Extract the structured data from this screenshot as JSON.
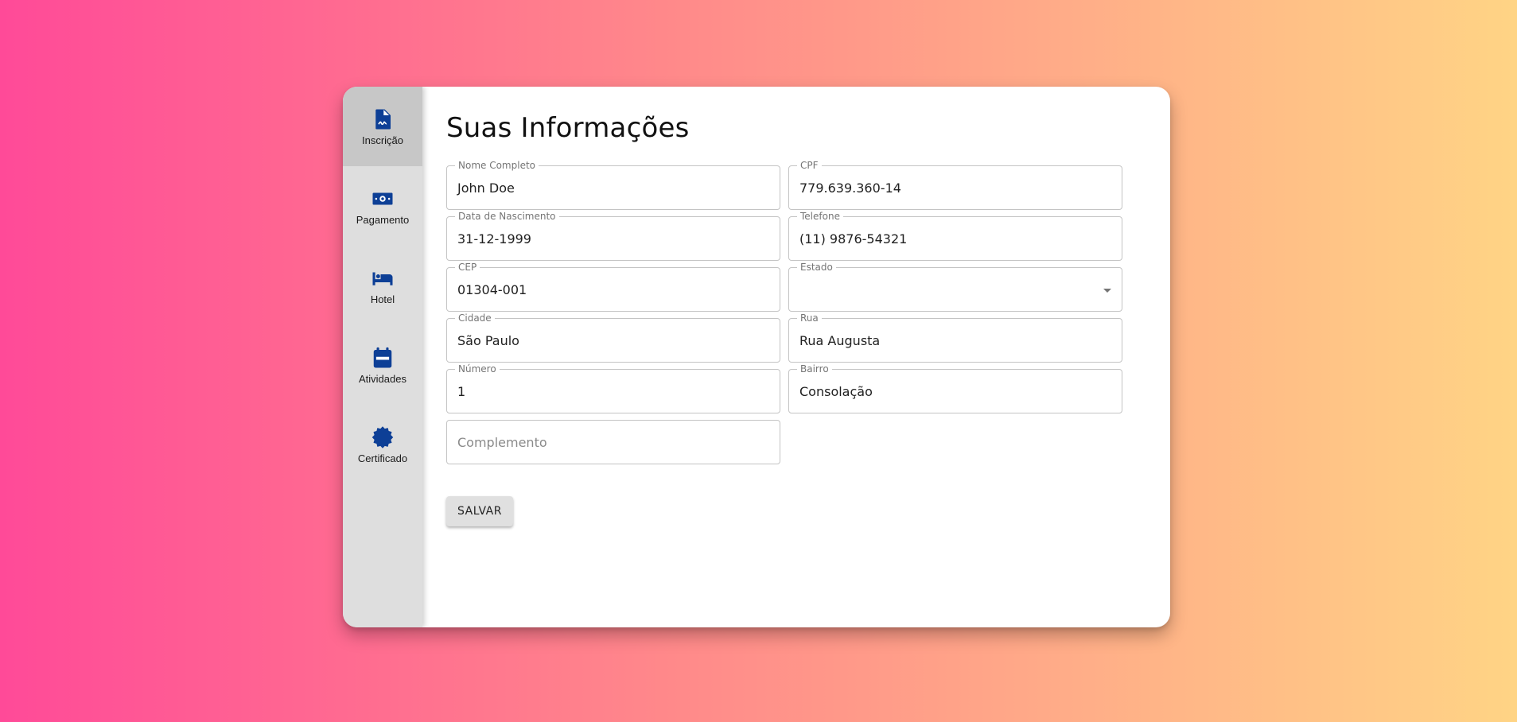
{
  "theme": {
    "accent": "#0d3f96",
    "sidebar_bg": "#dedede",
    "active_bg": "#c7c7c7"
  },
  "sidebar": {
    "items": [
      {
        "label": "Inscrição",
        "icon": "document-signature-icon",
        "active": true
      },
      {
        "label": "Pagamento",
        "icon": "banknote-icon",
        "active": false
      },
      {
        "label": "Hotel",
        "icon": "bed-icon",
        "active": false
      },
      {
        "label": "Atividades",
        "icon": "calendar-icon",
        "active": false
      },
      {
        "label": "Certificado",
        "icon": "certificate-badge-icon",
        "active": false
      }
    ]
  },
  "main": {
    "title": "Suas Informações",
    "fields": {
      "nome": {
        "label": "Nome Completo",
        "value": "John Doe"
      },
      "cpf": {
        "label": "CPF",
        "value": "779.639.360-14"
      },
      "nascimento": {
        "label": "Data de Nascimento",
        "value": "31-12-1999"
      },
      "telefone": {
        "label": "Telefone",
        "value": "(11) 9876-54321"
      },
      "cep": {
        "label": "CEP",
        "value": "01304-001"
      },
      "estado": {
        "label": "Estado",
        "value": ""
      },
      "cidade": {
        "label": "Cidade",
        "value": "São Paulo"
      },
      "rua": {
        "label": "Rua",
        "value": "Rua Augusta"
      },
      "numero": {
        "label": "Número",
        "value": "1"
      },
      "bairro": {
        "label": "Bairro",
        "value": "Consolação"
      },
      "complemento": {
        "placeholder": "Complemento",
        "value": ""
      }
    },
    "save_label": "SALVAR"
  }
}
